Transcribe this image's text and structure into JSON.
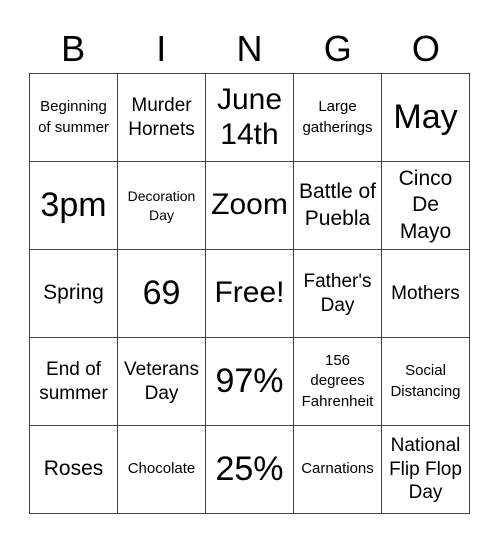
{
  "header": {
    "letters": [
      "B",
      "I",
      "N",
      "G",
      "O"
    ]
  },
  "grid": [
    [
      "Beginning of summer",
      "Murder Hornets",
      "June 14th",
      "Large gatherings",
      "May"
    ],
    [
      "3pm",
      "Decoration Day",
      "Zoom",
      "Battle of Puebla",
      "Cinco De Mayo"
    ],
    [
      "Spring",
      "69",
      "Free!",
      "Father's Day",
      "Mothers"
    ],
    [
      "End of summer",
      "Veterans Day",
      "97%",
      "156 degrees Fahrenheit",
      "Social Distancing"
    ],
    [
      "Roses",
      "Chocolate",
      "25%",
      "Carnations",
      "National Flip Flop Day"
    ]
  ]
}
